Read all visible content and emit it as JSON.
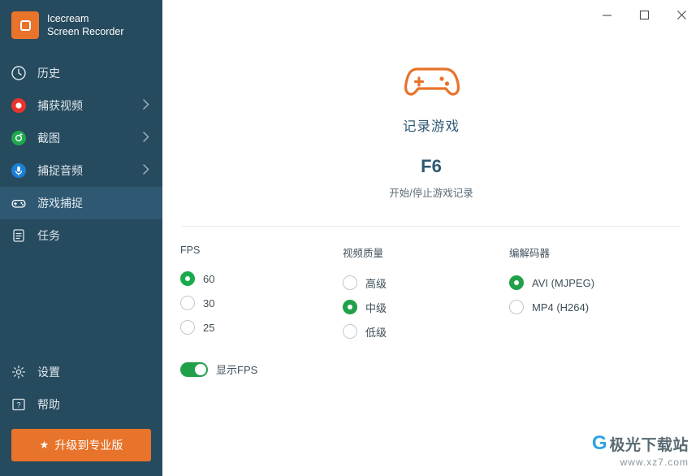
{
  "brand": {
    "line1": "Icecream",
    "line2": "Screen Recorder",
    "logo_icon": "app-logo-icon"
  },
  "titlebar": {
    "minimize_icon": "minimize-icon",
    "maximize_icon": "maximize-icon",
    "close_icon": "close-icon"
  },
  "sidebar": {
    "items": [
      {
        "label": "历史",
        "icon": "clock-icon",
        "active": false,
        "arrow": false
      },
      {
        "label": "捕获视频",
        "icon": "record-circle-icon",
        "active": false,
        "arrow": true
      },
      {
        "label": "截图",
        "icon": "camera-icon",
        "active": false,
        "arrow": true
      },
      {
        "label": "捕捉音频",
        "icon": "microphone-icon",
        "active": false,
        "arrow": true
      },
      {
        "label": "游戏捕捉",
        "icon": "gamepad-icon",
        "active": true,
        "arrow": false
      },
      {
        "label": "任务",
        "icon": "tasks-icon",
        "active": false,
        "arrow": false
      }
    ],
    "bottom_items": [
      {
        "label": "设置",
        "icon": "gear-icon"
      },
      {
        "label": "帮助",
        "icon": "help-icon"
      }
    ],
    "upgrade_label": "升级到专业版",
    "upgrade_icon": "star-icon"
  },
  "hero": {
    "icon": "gamepad-large-icon",
    "title": "记录游戏",
    "hotkey": "F6",
    "subtitle": "开始/停止游戏记录"
  },
  "settings": {
    "fps": {
      "title": "FPS",
      "options": [
        {
          "label": "60",
          "selected": true
        },
        {
          "label": "30",
          "selected": false
        },
        {
          "label": "25",
          "selected": false
        }
      ]
    },
    "quality": {
      "title": "视频质量",
      "options": [
        {
          "label": "高级",
          "selected": false
        },
        {
          "label": "中级",
          "selected": true
        },
        {
          "label": "低级",
          "selected": false
        }
      ]
    },
    "codec": {
      "title": "编解码器",
      "options": [
        {
          "label": "AVI (MJPEG)",
          "selected": true
        },
        {
          "label": "MP4 (H264)",
          "selected": false
        }
      ]
    },
    "show_fps": {
      "label": "显示FPS",
      "enabled": true
    }
  },
  "watermark": {
    "logo": "G",
    "text": "极光下载站",
    "sub": "www.xz7.com"
  },
  "colors": {
    "sidebar": "#264a5e",
    "sidebar_active": "#2f5972",
    "accent_orange": "#e8732a",
    "accent_green": "#21a04a",
    "text_primary": "#2f5972"
  }
}
